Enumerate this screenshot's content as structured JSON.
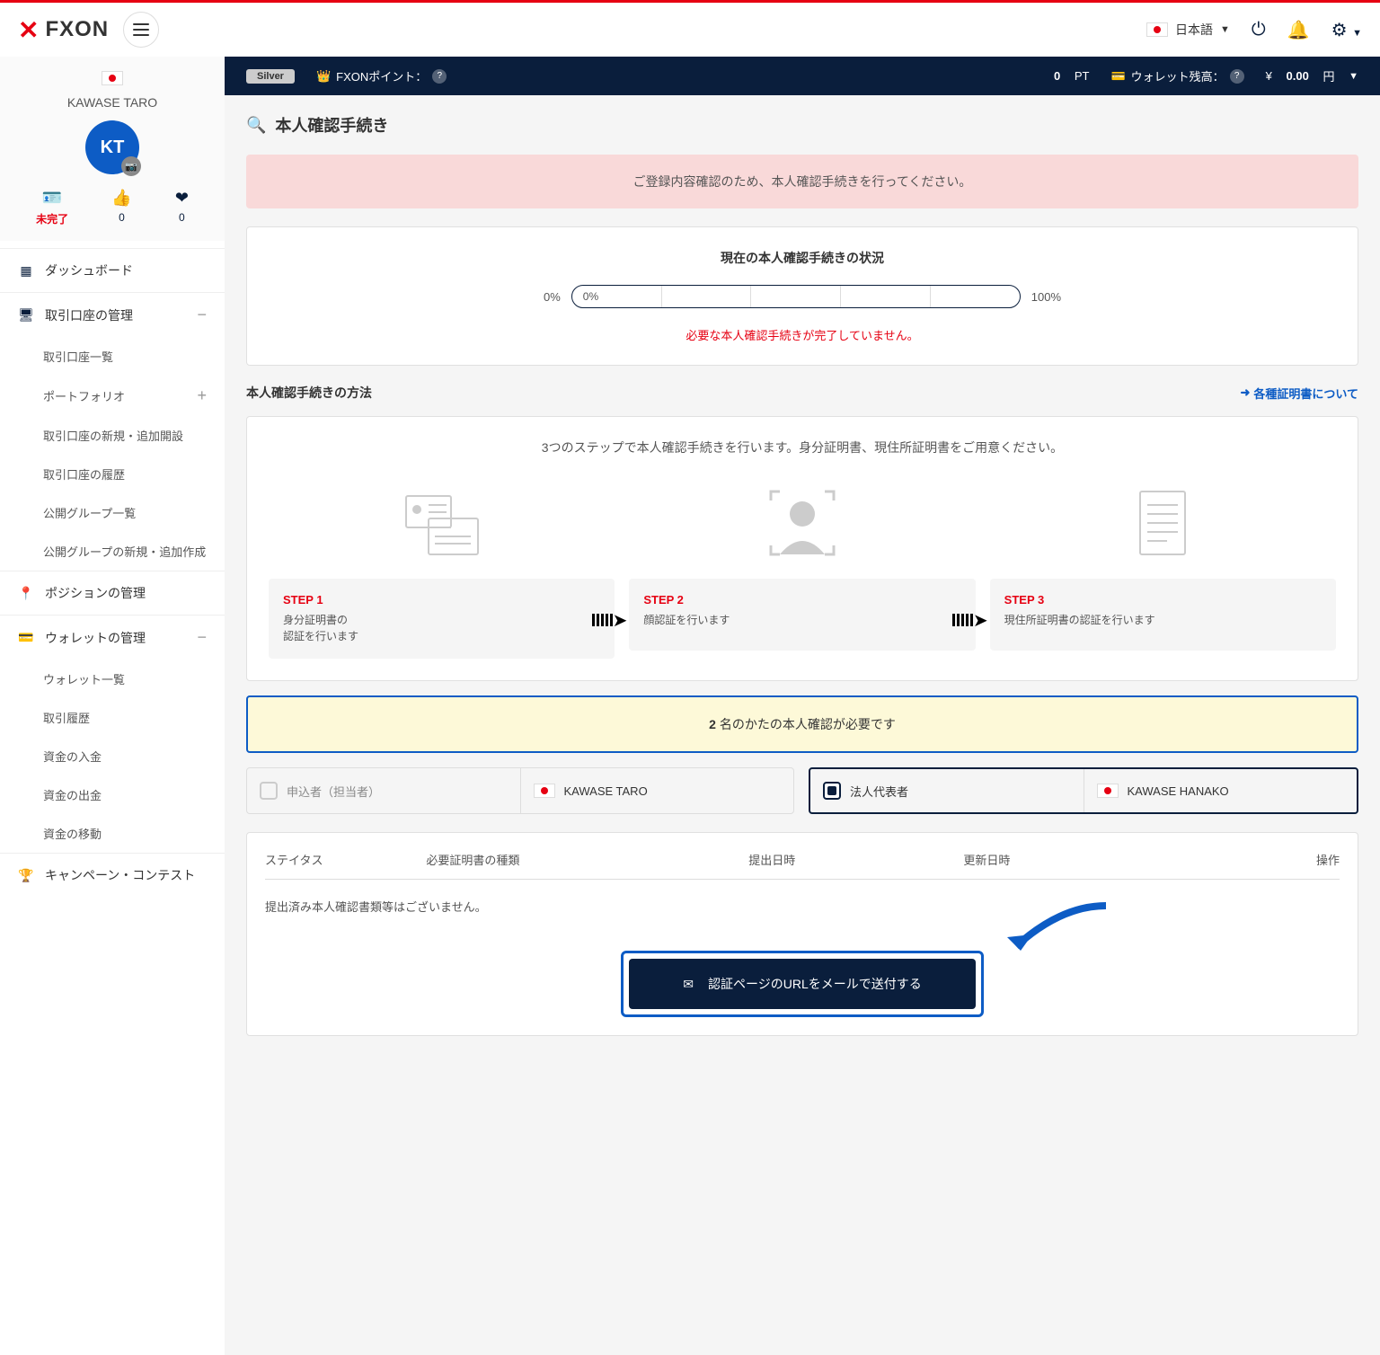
{
  "header": {
    "logo": "FXON",
    "language": "日本語"
  },
  "status_bar": {
    "silver": "Silver",
    "points_label": "FXONポイント：",
    "points_value": "0",
    "points_unit": "PT",
    "wallet_label": "ウォレット残高：",
    "wallet_currency": "¥",
    "wallet_value": "0.00",
    "wallet_unit": "円"
  },
  "sidebar": {
    "user_name": "KAWASE TARO",
    "avatar_initials": "KT",
    "stats": {
      "incomplete": "未完了",
      "likes": "0",
      "favorites": "0"
    },
    "nav": {
      "dashboard": "ダッシュボード",
      "account_mgmt": "取引口座の管理",
      "account_list": "取引口座一覧",
      "portfolio": "ポートフォリオ",
      "new_account": "取引口座の新規・追加開設",
      "account_history": "取引口座の履歴",
      "group_list": "公開グループ一覧",
      "new_group": "公開グループの新規・追加作成",
      "position_mgmt": "ポジションの管理",
      "wallet_mgmt": "ウォレットの管理",
      "wallet_list": "ウォレット一覧",
      "tx_history": "取引履歴",
      "deposit": "資金の入金",
      "withdraw": "資金の出金",
      "transfer": "資金の移動",
      "campaign": "キャンペーン・コンテスト"
    }
  },
  "page": {
    "title": "本人確認手続き",
    "notice": "ご登録内容確認のため、本人確認手続きを行ってください。",
    "progress": {
      "title": "現在の本人確認手続きの状況",
      "left": "0%",
      "right": "100%",
      "inner": "0%",
      "note": "必要な本人確認手続きが完了していません。"
    },
    "method": {
      "title": "本人確認手続きの方法",
      "link": "各種証明書について",
      "intro": "3つのステップで本人確認手続きを行います。身分証明書、現住所証明書をご用意ください。",
      "step1_label": "STEP 1",
      "step1_desc": "身分証明書の\n認証を行います",
      "step2_label": "STEP 2",
      "step2_desc": "顔認証を行います",
      "step3_label": "STEP 3",
      "step3_desc": "現住所証明書の認証を行います"
    },
    "yellow_notice_count": "2",
    "yellow_notice_text": " 名のかたの本人確認が必要です",
    "person1": {
      "role": "申込者（担当者）",
      "name": "KAWASE TARO"
    },
    "person2": {
      "role": "法人代表者",
      "name": "KAWASE HANAKO"
    },
    "table": {
      "status": "ステイタス",
      "type": "必要証明書の種類",
      "submitted": "提出日時",
      "updated": "更新日時",
      "action": "操作",
      "empty": "提出済み本人確認書類等はございません。"
    },
    "send_button": "認証ページのURLをメールで送付する"
  }
}
